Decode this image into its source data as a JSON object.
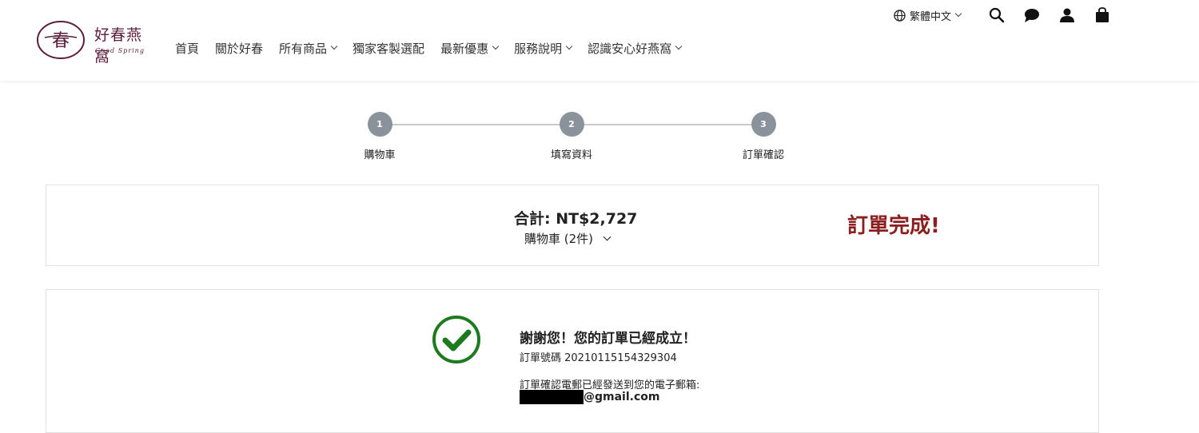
{
  "brand": {
    "name_cn": "好春燕窩",
    "name_en": "Good Spring",
    "seal_char": "春",
    "color": "#5a1f3a"
  },
  "nav": {
    "items": [
      {
        "label": "首頁",
        "has_dropdown": false
      },
      {
        "label": "關於好春",
        "has_dropdown": false
      },
      {
        "label": "所有商品",
        "has_dropdown": true
      },
      {
        "label": "獨家客製選配",
        "has_dropdown": false
      },
      {
        "label": "最新優惠",
        "has_dropdown": true
      },
      {
        "label": "服務說明",
        "has_dropdown": true
      },
      {
        "label": "認識安心好燕窩",
        "has_dropdown": true
      }
    ]
  },
  "tools": {
    "language": "繁體中文",
    "icons": [
      "globe-icon",
      "search-icon",
      "chat-icon",
      "user-icon",
      "shopping-bag-icon"
    ]
  },
  "steps": [
    {
      "number": "1",
      "label": "購物車"
    },
    {
      "number": "2",
      "label": "填寫資料"
    },
    {
      "number": "3",
      "label": "訂單確認"
    }
  ],
  "summary": {
    "total": "合計: NT$2,727",
    "cart": "購物車 (2件)",
    "status": "訂單完成!",
    "status_color": "#8b1e1e"
  },
  "confirmation": {
    "thanks": "謝謝您！您的訂單已經成立！",
    "order_number": "訂單號碼 20210115154329304",
    "email_note": "訂單確認電郵已經發送到您的電子郵箱:",
    "email_domain": "@gmail.com",
    "check_color": "#1e7a1e"
  }
}
